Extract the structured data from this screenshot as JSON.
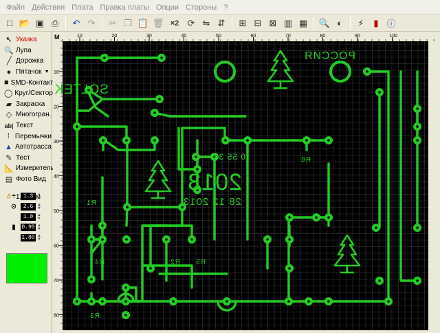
{
  "menu": [
    "Файл",
    "Действия",
    "Плата",
    "Правка платы",
    "Опции",
    "Стороны",
    "?"
  ],
  "toolbar": {
    "zoom_label": "×2",
    "icons": [
      "new-file-icon",
      "open-icon",
      "save-icon",
      "print-icon",
      "undo-icon",
      "redo-icon",
      "cut-icon",
      "copy-icon",
      "paste-icon",
      "delete-icon",
      "zoom2-icon",
      "rotate-icon",
      "mirror-h-icon",
      "mirror-v-icon",
      "align-icon",
      "group-icon",
      "ungroup-icon",
      "clone-icon",
      "macro-icon",
      "find-icon",
      "contrast-icon",
      "autoroute-icon",
      "component-icon",
      "info-icon"
    ]
  },
  "tools": [
    {
      "label": "Указка",
      "icon": "pointer-icon",
      "active": true
    },
    {
      "label": "Лупа",
      "icon": "magnifier-icon"
    },
    {
      "label": "Дорожка",
      "icon": "track-icon"
    },
    {
      "label": "Пятачок",
      "icon": "pad-icon",
      "dropdown": true
    },
    {
      "label": "SMD-Контакт",
      "icon": "smd-pad-icon"
    },
    {
      "label": "Круг/Сектор",
      "icon": "circle-icon"
    },
    {
      "label": "Закраска",
      "icon": "fill-icon"
    },
    {
      "label": "Многогран.",
      "icon": "polygon-icon"
    },
    {
      "label": "Текст",
      "icon": "text-icon"
    },
    {
      "label": "Перемычки",
      "icon": "jumper-icon"
    },
    {
      "label": "Автотрасса",
      "icon": "autoroute-tool-icon"
    },
    {
      "label": "Тест",
      "icon": "test-icon"
    },
    {
      "label": "Измеритель",
      "icon": "ruler-icon"
    },
    {
      "label": "Фото Вид",
      "icon": "photo-view-icon"
    }
  ],
  "grid_label": "1,27 мм",
  "params": {
    "track_width": "1.3",
    "pad_outer": "2.6",
    "pad_inner": "1.0",
    "smd_w": "0.90",
    "smd_h": "1.80"
  },
  "layer_color": "#00ee00",
  "ruler": {
    "corner": "M",
    "x_ticks": [
      "10",
      "20",
      "30",
      "40",
      "50",
      "60",
      "70",
      "80",
      "90",
      "100"
    ],
    "y_ticks": [
      "10",
      "20",
      "30",
      "40",
      "50",
      "60",
      "70",
      "80"
    ]
  },
  "board_text": {
    "brand": "SOLTEK",
    "country": "РОССИЯ",
    "serial": "0 55 34",
    "year": "2013",
    "date": "28 12 2013",
    "labels": [
      "R6",
      "R4",
      "R2",
      "R5",
      "R1",
      "R3"
    ]
  },
  "colors": {
    "copper": "#22cc22",
    "board": "#000000",
    "grid": "#3a3a3a"
  }
}
